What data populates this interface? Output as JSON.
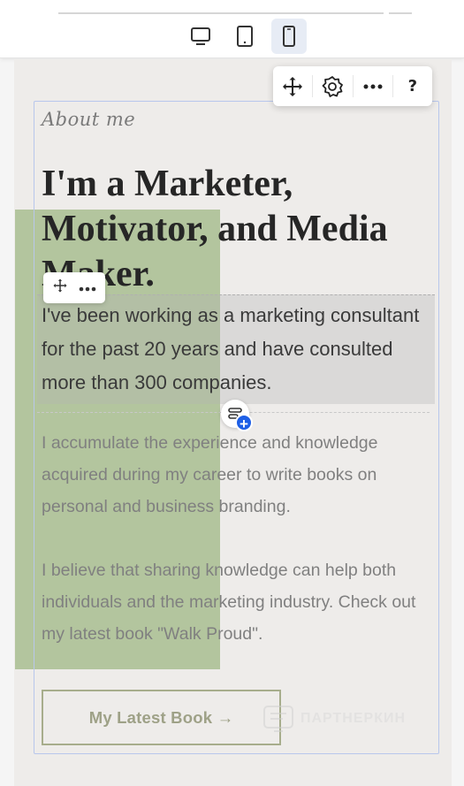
{
  "device_bar": {
    "devices": [
      {
        "name": "desktop",
        "active": false
      },
      {
        "name": "tablet",
        "active": false
      },
      {
        "name": "mobile",
        "active": true
      }
    ]
  },
  "floating_toolbar": {
    "items": [
      "move-icon",
      "settings-icon",
      "more-icon"
    ],
    "help_label": "?"
  },
  "section": {
    "label": "About me",
    "headline": "I'm a Marketer, Motivator, and Media Maker.",
    "lead": "I've been working as a marketing consultant for the past 20 years and have consulted more than 300 companies.",
    "paragraph_1": "I accumulate the experience and knowledge acquired during my career to write books on personal and business branding.",
    "paragraph_2": "I believe that sharing knowledge can help both individuals and the marketing industry. Check out my latest book \"Walk Proud\".",
    "cta_label": "My Latest Book →"
  },
  "watermark": {
    "text": "ПАРТНЕРКИН"
  },
  "colors": {
    "accent_blue": "#1e5fe6",
    "selection_border": "#b8c7ec",
    "green_overlay": "#96b27a",
    "canvas_bg": "#eeecea",
    "cta_border": "#a7ad8c"
  }
}
